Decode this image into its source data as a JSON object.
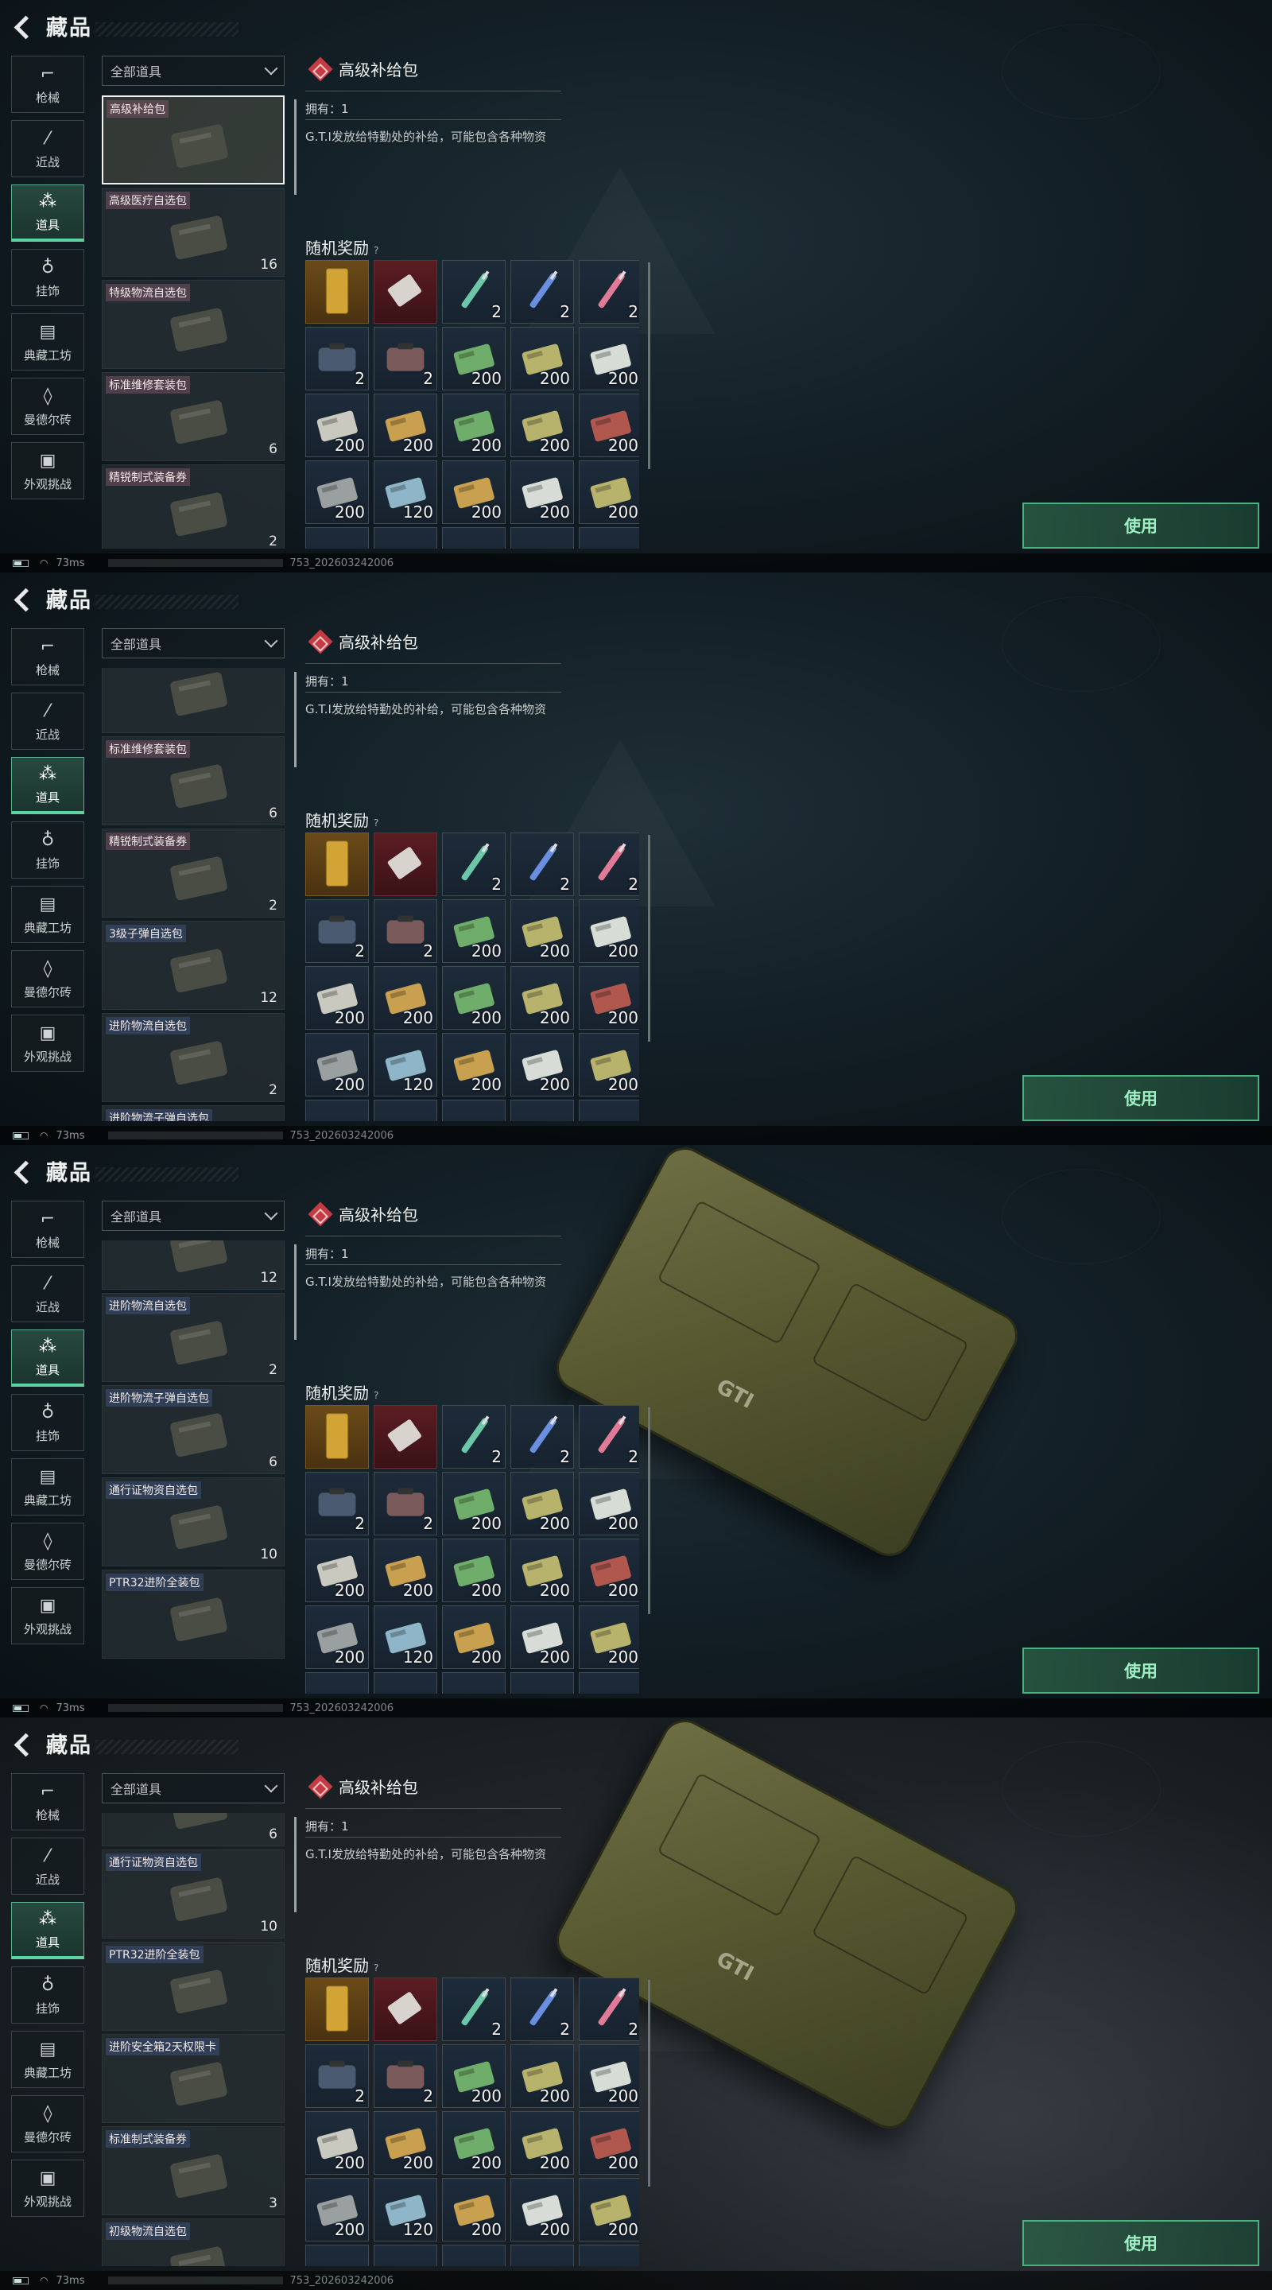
{
  "header": {
    "title": "藏品"
  },
  "nav": [
    {
      "label": "枪械",
      "icon": "gun-icon",
      "glyph": "⌐",
      "active": false
    },
    {
      "label": "近战",
      "icon": "knife-icon",
      "glyph": "⁄",
      "active": false
    },
    {
      "label": "道具",
      "icon": "items-icon",
      "glyph": "⁂",
      "active": true
    },
    {
      "label": "挂饰",
      "icon": "charm-icon",
      "glyph": "♁",
      "active": false
    },
    {
      "label": "典藏工坊",
      "icon": "workshop-icon",
      "glyph": "▤",
      "active": false
    },
    {
      "label": "曼德尔砖",
      "icon": "brick-icon",
      "glyph": "◊",
      "active": false
    },
    {
      "label": "外观挑战",
      "icon": "challenge-icon",
      "glyph": "▣",
      "active": false
    }
  ],
  "filter": {
    "label": "全部道具"
  },
  "detail": {
    "name": "高级补给包",
    "owned": "拥有：1",
    "description": "G.T.I发放给特勤处的补给，可能包含各种物资",
    "rewards_title": "随机奖励",
    "rewards_help": "?",
    "use_label": "使用"
  },
  "rewards": [
    {
      "count": "",
      "style": "gold",
      "icon": "gold-bar-icon"
    },
    {
      "count": "",
      "style": "red",
      "icon": "card-icon"
    },
    {
      "count": "2",
      "style": "blue",
      "icon": "syringe-green-icon"
    },
    {
      "count": "2",
      "style": "blue",
      "icon": "syringe-blue-icon"
    },
    {
      "count": "2",
      "style": "blue",
      "icon": "syringe-pink-icon"
    },
    {
      "count": "2",
      "style": "blue",
      "icon": "bag-icon"
    },
    {
      "count": "2",
      "style": "blue",
      "icon": "bag-red-icon"
    },
    {
      "count": "200",
      "style": "blue",
      "icon": "ammo-green-icon"
    },
    {
      "count": "200",
      "style": "blue",
      "icon": "ammo-olive-icon"
    },
    {
      "count": "200",
      "style": "blue",
      "icon": "ammo-white-icon"
    },
    {
      "count": "200",
      "style": "blue",
      "icon": "ammo-crate-icon"
    },
    {
      "count": "200",
      "style": "blue",
      "icon": "ammo-tan-icon"
    },
    {
      "count": "200",
      "style": "blue",
      "icon": "ammo-green-icon"
    },
    {
      "count": "200",
      "style": "blue",
      "icon": "ammo-olive-icon"
    },
    {
      "count": "200",
      "style": "blue",
      "icon": "ammo-red-icon"
    },
    {
      "count": "200",
      "style": "blue",
      "icon": "ammo-gray-icon"
    },
    {
      "count": "120",
      "style": "blue",
      "icon": "ammo-blue-icon"
    },
    {
      "count": "200",
      "style": "blue",
      "icon": "ammo-tan-icon"
    },
    {
      "count": "200",
      "style": "blue",
      "icon": "ammo-white-icon"
    },
    {
      "count": "200",
      "style": "blue",
      "icon": "ammo-olive-icon"
    }
  ],
  "status": {
    "ping": "73ms",
    "uid": "753_202603242006"
  },
  "frames": [
    {
      "list": [
        {
          "name": "高级补给包",
          "count": "",
          "tag": "red",
          "selected": true
        },
        {
          "name": "高级医疗自选包",
          "count": "16",
          "tag": "red"
        },
        {
          "name": "特级物流自选包",
          "count": "",
          "tag": "red"
        },
        {
          "name": "标准维修套装包",
          "count": "6",
          "tag": "red"
        },
        {
          "name": "精锐制式装备券",
          "count": "2",
          "tag": "red"
        }
      ],
      "box": false,
      "dark": false
    },
    {
      "list": [
        {
          "name": "",
          "count": "",
          "tag": "red"
        },
        {
          "name": "标准维修套装包",
          "count": "6",
          "tag": "red"
        },
        {
          "name": "精锐制式装备券",
          "count": "2",
          "tag": "red"
        },
        {
          "name": "3级子弹自选包",
          "count": "12",
          "tag": "blue"
        },
        {
          "name": "进阶物流自选包",
          "count": "2",
          "tag": "blue"
        },
        {
          "name": "进阶物流子弹自选包",
          "count": "",
          "tag": "blue"
        }
      ],
      "box": false,
      "dark": false
    },
    {
      "list": [
        {
          "name": "",
          "count": "12",
          "tag": "blue"
        },
        {
          "name": "进阶物流自选包",
          "count": "2",
          "tag": "blue"
        },
        {
          "name": "进阶物流子弹自选包",
          "count": "6",
          "tag": "blue"
        },
        {
          "name": "通行证物资自选包",
          "count": "10",
          "tag": "blue"
        },
        {
          "name": "PTR32进阶全装包",
          "count": "",
          "tag": "blue"
        }
      ],
      "box": true,
      "dark": false,
      "box_label": "GTI"
    },
    {
      "list": [
        {
          "name": "",
          "count": "6",
          "tag": "blue"
        },
        {
          "name": "通行证物资自选包",
          "count": "10",
          "tag": "blue"
        },
        {
          "name": "PTR32进阶全装包",
          "count": "",
          "tag": "blue"
        },
        {
          "name": "进阶安全箱2天权限卡",
          "count": "",
          "tag": "blue"
        },
        {
          "name": "标准制式装备券",
          "count": "3",
          "tag": "blue"
        },
        {
          "name": "初级物流自选包",
          "count": "",
          "tag": "blue"
        }
      ],
      "box": true,
      "dark": true,
      "box_label": "GTI"
    }
  ]
}
